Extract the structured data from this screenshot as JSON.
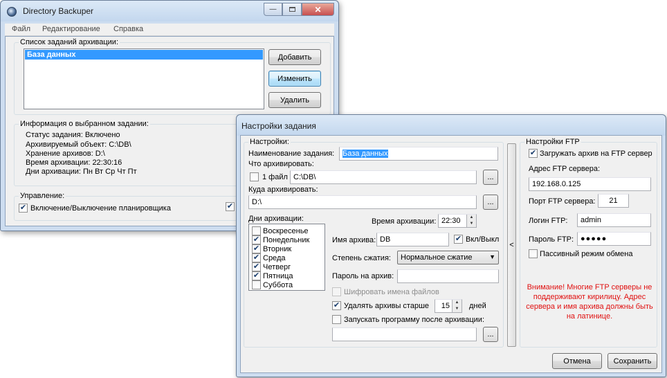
{
  "main_window": {
    "title": "Directory Backuper",
    "menu": [
      "Файл",
      "Редактирование",
      "Справка"
    ],
    "tasks_group_label": "Список заданий архивации:",
    "tasks": [
      "База данных"
    ],
    "buttons": {
      "add": "Добавить",
      "edit": "Изменить",
      "delete": "Удалить"
    },
    "info_group_label": "Информация о выбранном задании:",
    "info": {
      "status": "Статус задания: Включено",
      "object": "Архивируемый объект: C:\\DB\\",
      "storage": "Хранение архивов: D:\\",
      "time": "Время архивации: 22:30:16",
      "days": "Дни архивации: Пн Вт Ср Чт Пт"
    },
    "control_group_label": "Управление:",
    "scheduler_toggle": {
      "label": "Включение/Выключение планировщика",
      "checked": true
    }
  },
  "dialog": {
    "title": "Настройки задания",
    "settings_group_label": "Настройки:",
    "task_name_label": "Наименование задания:",
    "task_name_value": "База данных",
    "what_label": "Что архивировать:",
    "one_file_label": "1 файл",
    "source_path": "C:\\DB\\",
    "where_label": "Куда архивировать:",
    "dest_path": "D:\\",
    "browse_label": "...",
    "days_label": "Дни архивации:",
    "days": [
      {
        "label": "Воскресенье",
        "checked": false
      },
      {
        "label": "Понедельник",
        "checked": true
      },
      {
        "label": "Вторник",
        "checked": true
      },
      {
        "label": "Среда",
        "checked": true
      },
      {
        "label": "Четверг",
        "checked": true
      },
      {
        "label": "Пятница",
        "checked": true
      },
      {
        "label": "Суббота",
        "checked": false
      }
    ],
    "time_label": "Время архивации:",
    "time_value": "22:30",
    "archive_name_label": "Имя архива:",
    "archive_name_value": "DB",
    "archive_toggle_label": "Вкл/Выкл",
    "compression_label": "Степень сжатия:",
    "compression_value": "Нормальное сжатие",
    "password_label": "Пароль на архив:",
    "password_value": "",
    "encrypt_names_label": "Шифровать имена файлов",
    "delete_older_label": "Удалять архивы старше",
    "delete_older_value": "15",
    "days_unit": "дней",
    "run_after_label": "Запускать программу после архивации:",
    "run_after_value": "",
    "collapse_label": "<",
    "ftp": {
      "group_label": "Настройки FTP",
      "upload_label": "Загружать архив на FTP сервер",
      "address_label": "Адрес FTP сервера:",
      "address_value": "192.168.0.125",
      "port_label": "Порт FTP сервера:",
      "port_value": "21",
      "login_label": "Логин FTP:",
      "login_value": "admin",
      "password_label": "Пароль FTP:",
      "password_value": "●●●●●",
      "passive_label": "Пассивный режим обмена",
      "warning": "Внимание! Многие FTP серверы не поддерживают кирилицу. Адрес сервера и имя архива должны быть на латинице."
    },
    "cancel_label": "Отмена",
    "save_label": "Сохранить"
  },
  "colors": {
    "warning": "#e01010",
    "selection": "#3399ff",
    "check": "#1c3f6e"
  },
  "icons": [
    "app-icon",
    "minimize-icon",
    "maximize-icon",
    "close-icon",
    "checkmark-icon",
    "dropdown-arrow-icon",
    "spin-up-icon",
    "spin-down-icon"
  ]
}
